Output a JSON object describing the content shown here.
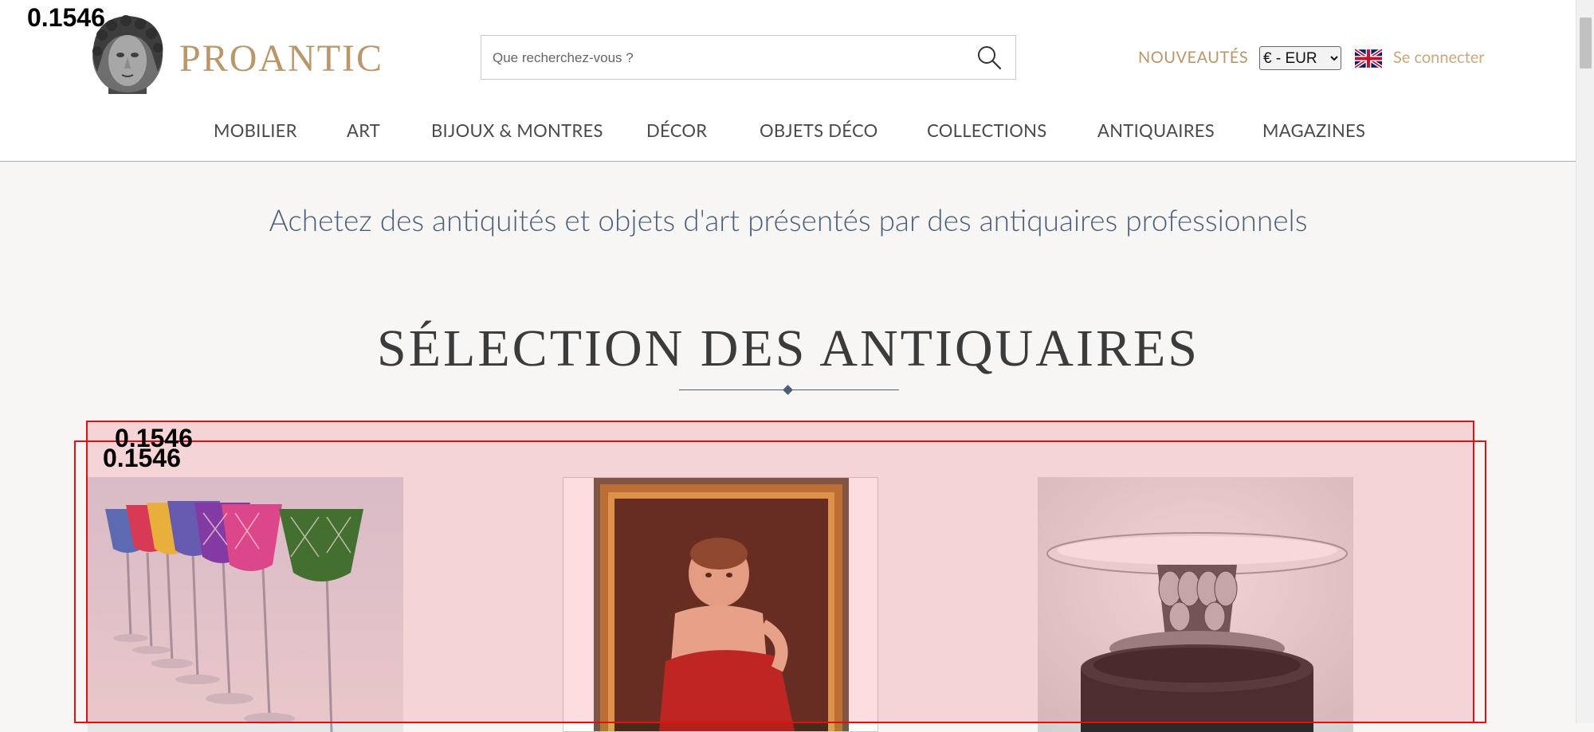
{
  "header": {
    "brand_name": "PROANTIC",
    "search_placeholder": "Que recherchez-vous ?",
    "nouveautes_label": "NOUVEAUTÉS",
    "currency_selected": "€ - EUR",
    "login_label": "Se connecter"
  },
  "nav": {
    "items": [
      "MOBILIER",
      "ART",
      "BIJOUX & MONTRES",
      "DÉCOR",
      "OBJETS DÉCO",
      "COLLECTIONS",
      "ANTIQUAIRES",
      "MAGAZINES"
    ]
  },
  "main": {
    "tagline": "Achetez des antiquités et objets d'art présentés par des antiquaires professionnels",
    "section_title": "SÉLECTION DES ANTIQUAIRES"
  },
  "detections": {
    "top_label": "0.1546",
    "box_a_label": "0.1546",
    "box_b_label": "0.1546"
  },
  "colors": {
    "brand_gold": "#b9976b",
    "accent_blue": "#4b5e78",
    "detection_red": "#e01010"
  },
  "icons": [
    "sculpture-logo-icon",
    "search-icon",
    "uk-flag-icon"
  ]
}
